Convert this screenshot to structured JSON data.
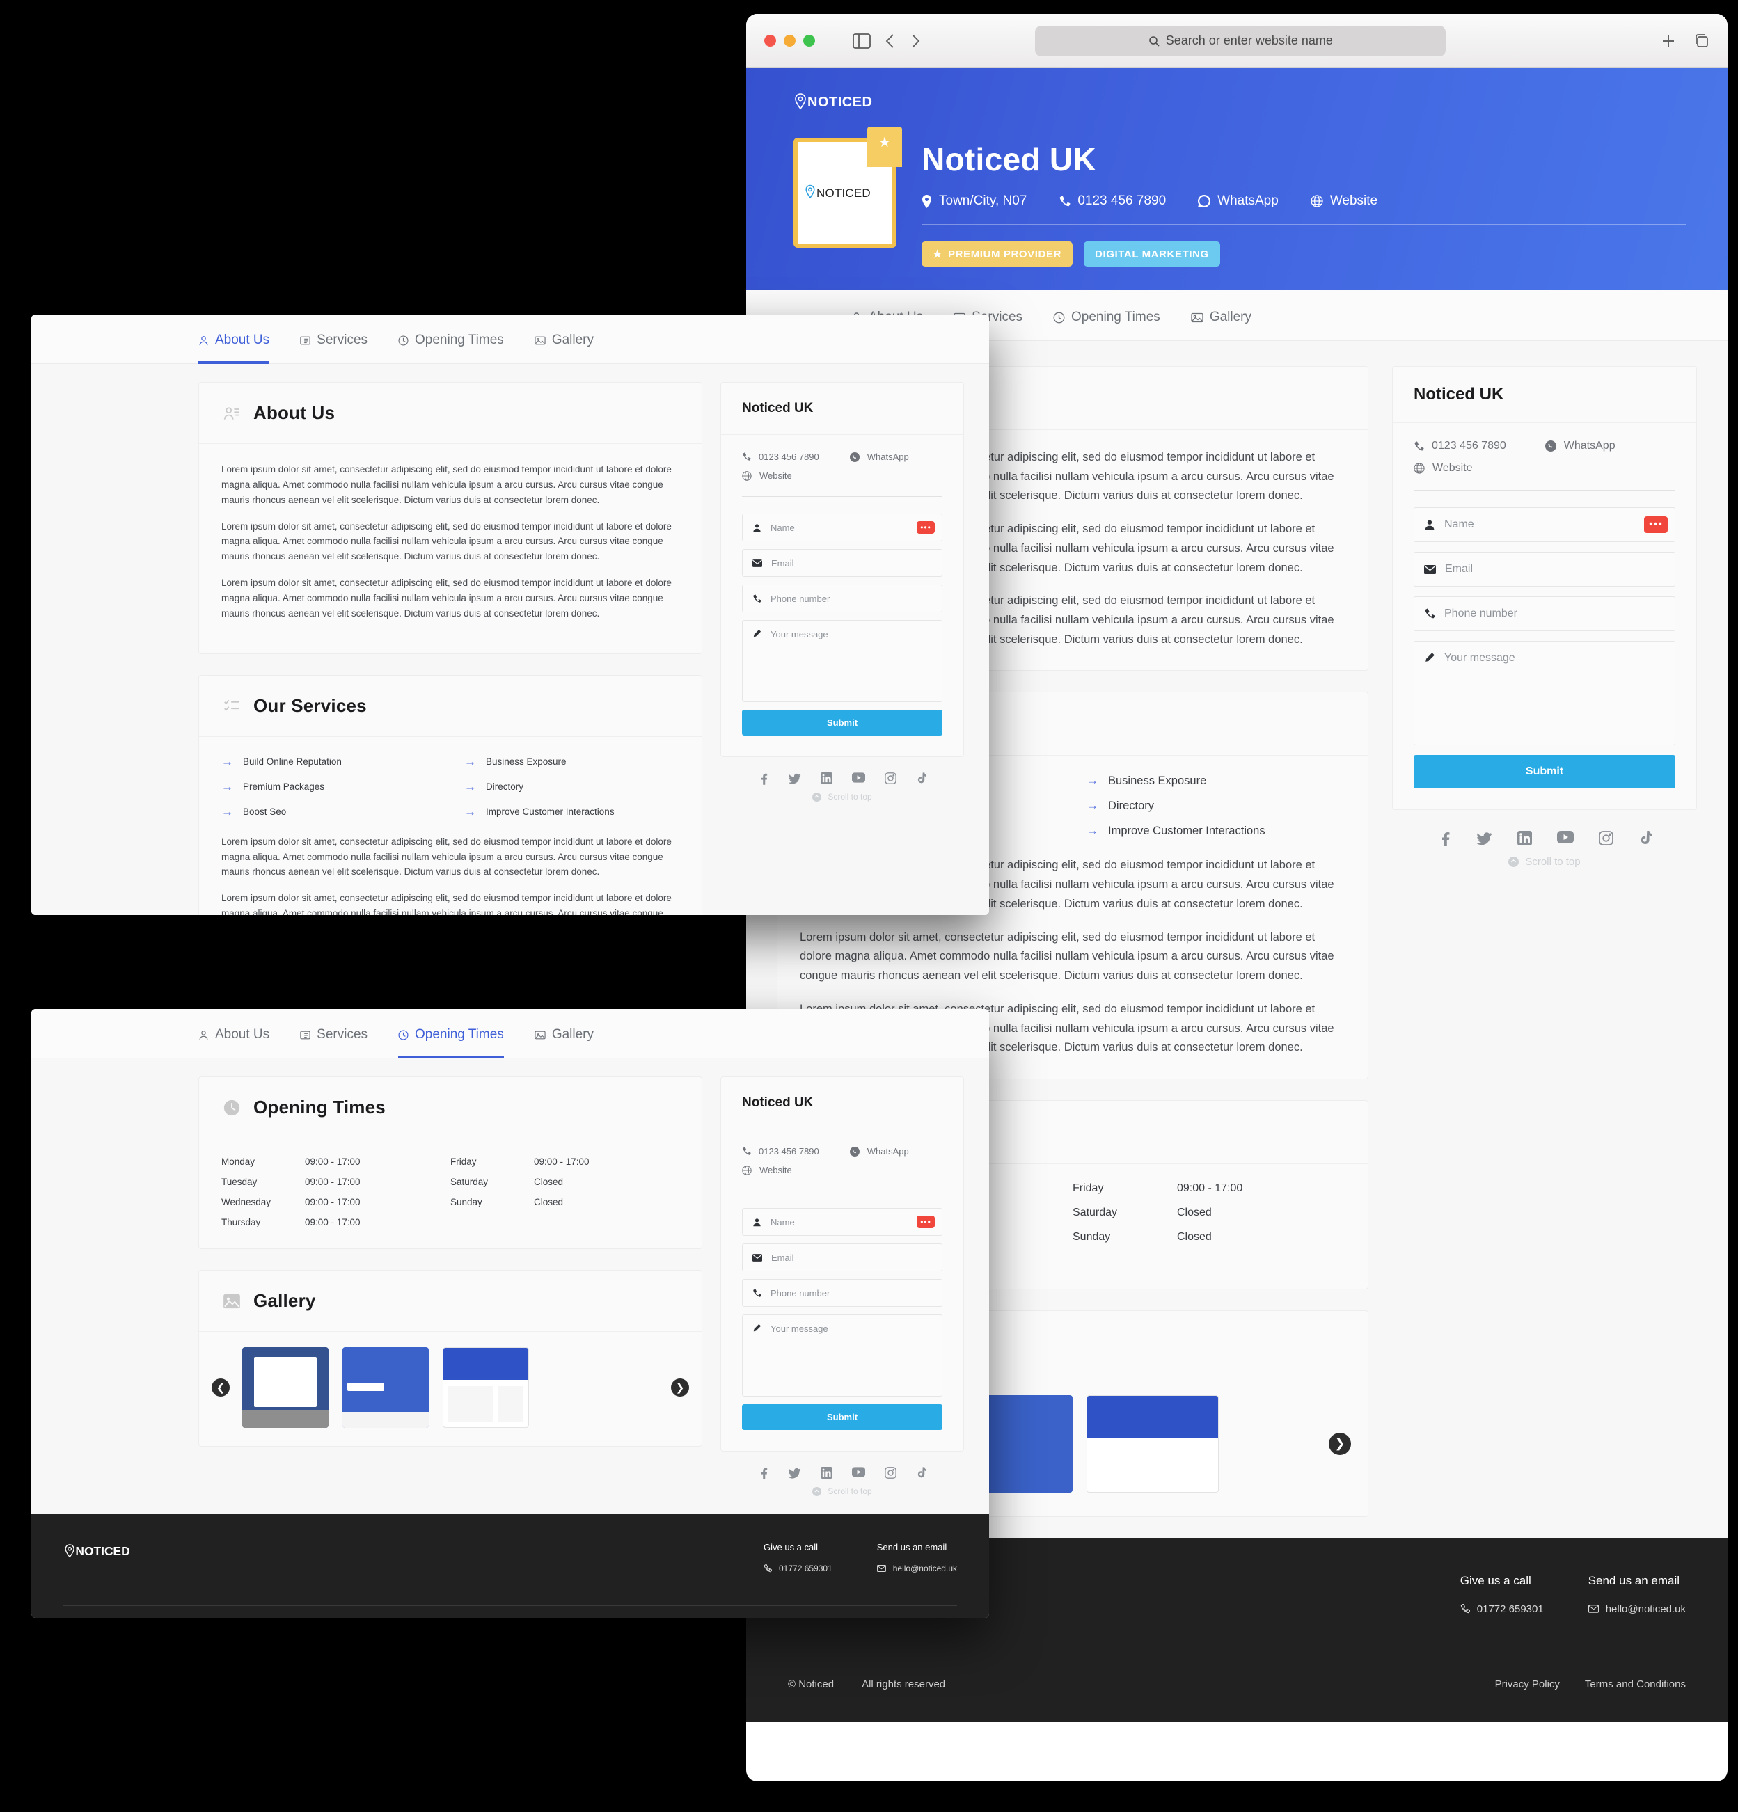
{
  "browser": {
    "placeholder": "Search or enter website name",
    "search_icon": "search-icon",
    "sidebar_icon": "sidebar-toggle-icon",
    "back_icon": "chevron-left-icon",
    "forward_icon": "chevron-right-icon",
    "new_tab_icon": "plus-icon",
    "tab_overview_icon": "tab-overview-icon"
  },
  "site": {
    "logo_text": "NOTICED",
    "accent_blue": "#3f5fd8",
    "submit_blue": "#29abe6",
    "badge_yellow": "#f3ce6c",
    "badge_cyan": "#6cc9f0"
  },
  "hero": {
    "business_name": "Noticed UK",
    "card_logo": "NOTICED",
    "location": "Town/City, N07",
    "phone": "0123 456 7890",
    "whatsapp": "WhatsApp",
    "website": "Website",
    "badge_premium": "PREMIUM PROVIDER",
    "badge_category": "DIGITAL MARKETING"
  },
  "tabs": [
    {
      "label": "About Us",
      "icon": "person-icon"
    },
    {
      "label": "Services",
      "icon": "list-icon"
    },
    {
      "label": "Opening Times",
      "icon": "clock-icon"
    },
    {
      "label": "Gallery",
      "icon": "image-icon"
    }
  ],
  "about": {
    "title": "About Us",
    "icon": "person-list-icon",
    "paragraph": "Lorem ipsum dolor sit amet, consectetur adipiscing elit, sed do eiusmod tempor incididunt ut labore et dolore magna aliqua. Amet commodo nulla facilisi nullam vehicula ipsum a arcu cursus. Arcu cursus vitae congue mauris rhoncus aenean vel elit scelerisque. Dictum varius duis at consectetur lorem donec."
  },
  "services": {
    "title": "Our Services",
    "icon": "checklist-icon",
    "items_left": [
      "Build Online Reputation",
      "Premium Packages",
      "Boost Seo"
    ],
    "items_right": [
      "Business Exposure",
      "Directory",
      "Improve Customer Interactions"
    ]
  },
  "opening_times": {
    "title": "Opening Times",
    "icon": "clock-icon",
    "left": [
      {
        "day": "Monday",
        "hours": "09:00 - 17:00"
      },
      {
        "day": "Tuesday",
        "hours": "09:00 - 17:00"
      },
      {
        "day": "Wednesday",
        "hours": "09:00 - 17:00"
      },
      {
        "day": "Thursday",
        "hours": "09:00 - 17:00"
      }
    ],
    "right": [
      {
        "day": "Friday",
        "hours": "09:00 - 17:00"
      },
      {
        "day": "Saturday",
        "hours": "Closed"
      },
      {
        "day": "Sunday",
        "hours": "Closed"
      }
    ]
  },
  "gallery": {
    "title": "Gallery",
    "icon": "image-icon",
    "prev_icon": "carousel-prev-icon",
    "next_icon": "carousel-next-icon",
    "thumbnails": [
      "modal-screenshot",
      "hero-illustration-screenshot",
      "profile-page-screenshot"
    ]
  },
  "contact": {
    "title": "Noticed UK",
    "phone": "0123 456 7890",
    "whatsapp": "WhatsApp",
    "website": "Website",
    "name_placeholder": "Name",
    "email_placeholder": "Email",
    "phone_placeholder": "Phone number",
    "message_placeholder": "Your message",
    "submit_label": "Submit",
    "password_chip": "•••",
    "scroll_top": "Scroll to top",
    "socials": [
      "facebook-icon",
      "twitter-icon",
      "linkedin-icon",
      "youtube-icon",
      "instagram-icon",
      "tiktok-icon"
    ]
  },
  "footer": {
    "logo_text": "NOTICED",
    "call_title": "Give us a call",
    "call_value": "01772 659301",
    "email_title": "Send us an email",
    "email_value": "hello@noticed.uk",
    "copyright": "© Noticed",
    "rights": "All rights reserved",
    "privacy": "Privacy Policy",
    "terms": "Terms and Conditions"
  }
}
